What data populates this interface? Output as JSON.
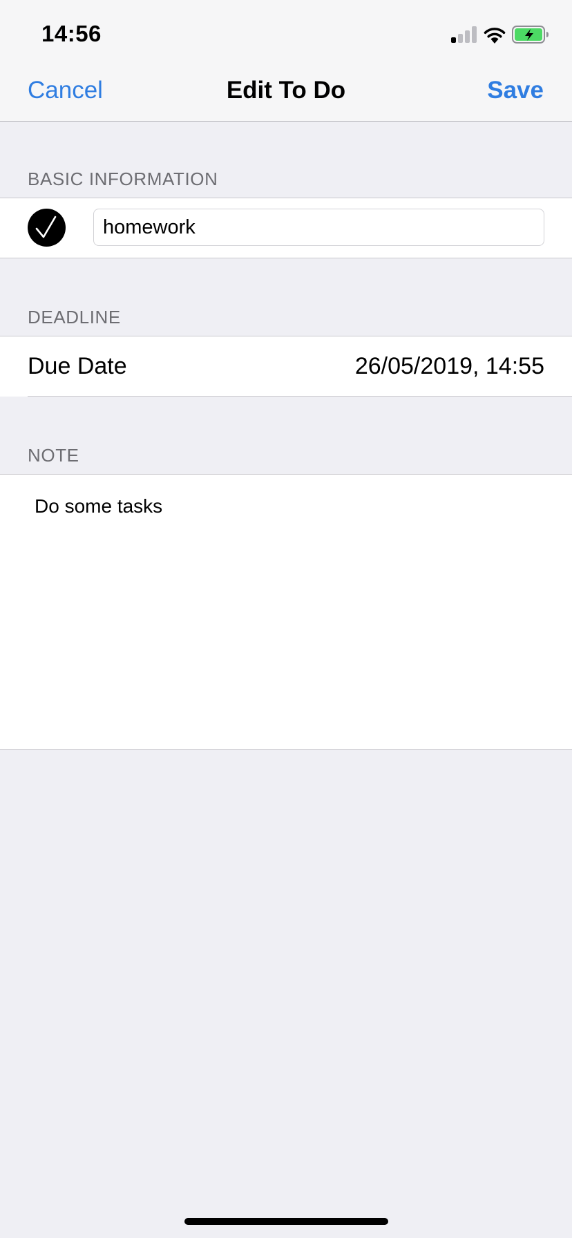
{
  "status_bar": {
    "time": "14:56",
    "signal_bars_active": 1,
    "signal_bars_total": 4,
    "battery_charging": true,
    "battery_color": "#4cd964"
  },
  "nav": {
    "cancel_label": "Cancel",
    "title": "Edit To Do",
    "save_label": "Save",
    "accent_color": "#2f7de1"
  },
  "basic_info": {
    "header": "BASIC INFORMATION",
    "completed": true,
    "title_value": "homework"
  },
  "deadline": {
    "header": "DEADLINE",
    "due_label": "Due Date",
    "due_value": "26/05/2019, 14:55"
  },
  "note": {
    "header": "NOTE",
    "text": "Do some tasks"
  }
}
